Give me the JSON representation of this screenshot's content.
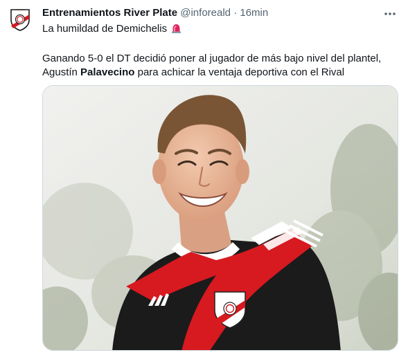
{
  "tweet": {
    "author_name": "Entrenamientos River Plate",
    "handle": "@inforeald",
    "separator": "·",
    "time": "16min",
    "line1": "La humildad de Demichelis",
    "line2": "Ganando 5-0 el DT decidió poner al jugador de más bajo nivel del plantel,",
    "line3_a": "Agustín ",
    "line3_bold": "Palavecino",
    "line3_b": " para achicar la ventaja deportiva con el Rival"
  },
  "icons": {
    "avatar": "river-plate-crest",
    "more": "more-dots-icon",
    "emoji": "siren-emoji"
  },
  "colors": {
    "text": "#0f1419",
    "secondary": "#536471",
    "river_red": "#d71920",
    "jersey_black": "#1a1a1a"
  }
}
